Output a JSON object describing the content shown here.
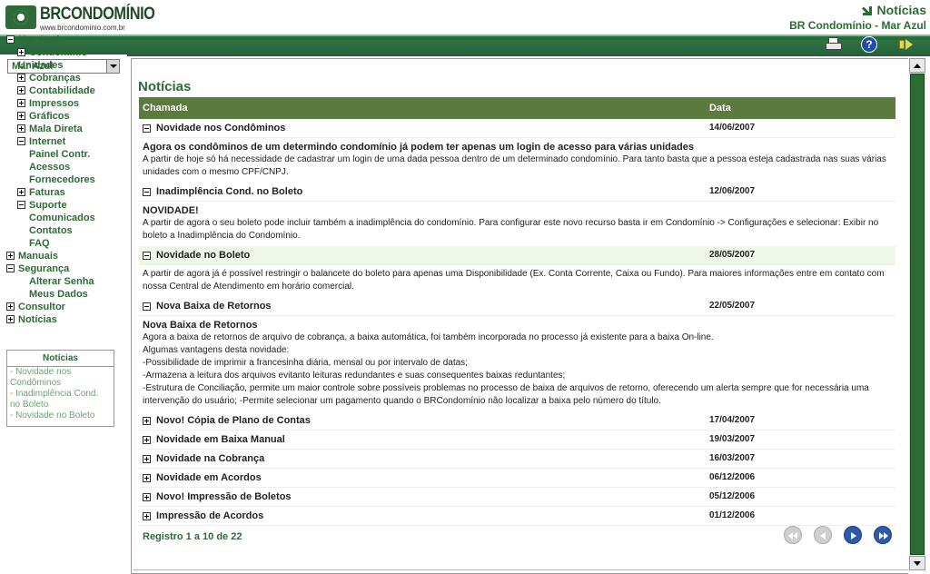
{
  "header": {
    "logo_text": "BRCONDOMÍNIO",
    "logo_url": "www.brcondominio.com.br",
    "section_title": "Notícias",
    "subtitle": "BR Condomínio - Mar Azul"
  },
  "toolbar": {
    "icons": [
      "printer-icon",
      "help-icon",
      "exit-icon"
    ],
    "help_glyph": "?"
  },
  "sidebar": {
    "company_select": "Mar Azul",
    "tree": [
      {
        "label": "Mar Azul",
        "level": 0,
        "toggle": "minus"
      },
      {
        "label": "Condomínio",
        "level": 1,
        "toggle": "plus"
      },
      {
        "label": "Unidades",
        "level": 0,
        "toggle": "none"
      },
      {
        "label": "Cobranças",
        "level": 1,
        "toggle": "plus"
      },
      {
        "label": "Contabilidade",
        "level": 1,
        "toggle": "plus"
      },
      {
        "label": "Impressos",
        "level": 1,
        "toggle": "plus"
      },
      {
        "label": "Gráficos",
        "level": 1,
        "toggle": "plus"
      },
      {
        "label": "Mala Direta",
        "level": 1,
        "toggle": "plus"
      },
      {
        "label": "Internet",
        "level": 1,
        "toggle": "minus"
      },
      {
        "label": "Painel Contr.",
        "level": 2,
        "toggle": "none"
      },
      {
        "label": "Acessos",
        "level": 2,
        "toggle": "none"
      },
      {
        "label": "Fornecedores",
        "level": 2,
        "toggle": "none"
      },
      {
        "label": "Faturas",
        "level": 1,
        "toggle": "plus"
      },
      {
        "label": "Suporte",
        "level": 1,
        "toggle": "minus"
      },
      {
        "label": "Comunicados",
        "level": 2,
        "toggle": "none"
      },
      {
        "label": "Contatos",
        "level": 2,
        "toggle": "none"
      },
      {
        "label": "FAQ",
        "level": 2,
        "toggle": "none"
      },
      {
        "label": "Manuais",
        "level": 0,
        "toggle": "plus"
      },
      {
        "label": "Segurança",
        "level": 0,
        "toggle": "minus"
      },
      {
        "label": "Alterar Senha",
        "level": 2,
        "toggle": "none"
      },
      {
        "label": "Meus Dados",
        "level": 2,
        "toggle": "none"
      },
      {
        "label": "Consultor",
        "level": 0,
        "toggle": "plus"
      },
      {
        "label": "Notícias",
        "level": 0,
        "toggle": "plus"
      }
    ],
    "news_box": {
      "title": "Notícias",
      "items": [
        "- Novidade nos Condôminos",
        "- Inadimplência Cond. no Boleto",
        "- Novidade no Boleto"
      ]
    }
  },
  "main": {
    "title": "Notícias",
    "columns": [
      "Chamada",
      "Data"
    ],
    "rows": [
      {
        "title": "Novidade nos Condôminos",
        "date": "14/06/2007",
        "expanded": true,
        "highlight": false,
        "heading": "Agora os condôminos de um determindo condomínio já podem ter apenas um login de acesso para várias unidades",
        "body": [
          "A partir de hoje só há necessidade de cadastrar um login de uma dada pessoa dentro de um determinado condomínio. Para tanto basta que a pessoa esteja cadastrada nas suas várias unidades com o mesmo CPF/CNPJ."
        ]
      },
      {
        "title": "Inadimplência Cond. no Boleto",
        "date": "12/06/2007",
        "expanded": true,
        "highlight": false,
        "heading": "NOVIDADE!",
        "body": [
          "A partir de agora o seu boleto pode incluir também a inadimplência do condomínio. Para configurar este novo recurso basta ir em Condomínio -> Configurações e selecionar: Exibir no boleto a Inadimplência do Condomínio."
        ]
      },
      {
        "title": "Novidade no Boleto",
        "date": "28/05/2007",
        "expanded": true,
        "highlight": true,
        "heading": "",
        "body": [
          "A partir de agora já é possível restringir o balancete do boleto para apenas uma Disponibilidade (Ex. Conta Corrente, Caixa ou Fundo). Para maiores informações entre em contato com nossa Central de Atendimento em horário comercial."
        ]
      },
      {
        "title": "Nova Baixa de Retornos",
        "date": "22/05/2007",
        "expanded": true,
        "highlight": false,
        "heading": "Nova Baixa de Retornos",
        "body": [
          "Agora a baixa de retornos de arquivo de cobrança, a baixa automática, foi também incorporada no processo já existente para a baixa On-line.",
          "Algumas vantagens desta novidade:",
          "-Possibilidade de imprimir a francesinha diária, mensal ou por intervalo de datas;",
          "-Armazena a leitura dos arquivos evitanto leituras redundantes e suas consequentes baixas reduntantes;",
          "-Estrutura de Conciliação, permite um maior controle sobre possíveis problemas no processo de baixa de arquivos de retorno, oferecendo um alerta sempre que for necessária uma intervenção do usuário; -Permite selecionar um pagamento quando o BRCondomínio não localizar a baixa pelo número do título."
        ]
      },
      {
        "title": "Novo! Cópia de Plano de Contas",
        "date": "17/04/2007",
        "expanded": false,
        "highlight": false
      },
      {
        "title": "Novidade em Baixa Manual",
        "date": "19/03/2007",
        "expanded": false,
        "highlight": false
      },
      {
        "title": "Novidade na Cobrança",
        "date": "16/03/2007",
        "expanded": false,
        "highlight": false
      },
      {
        "title": "Novidade em Acordos",
        "date": "06/12/2006",
        "expanded": false,
        "highlight": false
      },
      {
        "title": "Novo! Impressão de Boletos",
        "date": "05/12/2006",
        "expanded": false,
        "highlight": false
      },
      {
        "title": "Impressão de Acordos",
        "date": "01/12/2006",
        "expanded": false,
        "highlight": false
      }
    ],
    "pagination": {
      "label": "Registro 1 a 10 de 22",
      "buttons": [
        "first",
        "previous",
        "next",
        "last"
      ]
    }
  },
  "colors": {
    "brand_green": "#2d6b35",
    "header_bar": "#2a6b3d",
    "table_header": "#5b7a3e",
    "highlight_row": "#eef7e8",
    "pager_active": "#2c5aa8"
  }
}
